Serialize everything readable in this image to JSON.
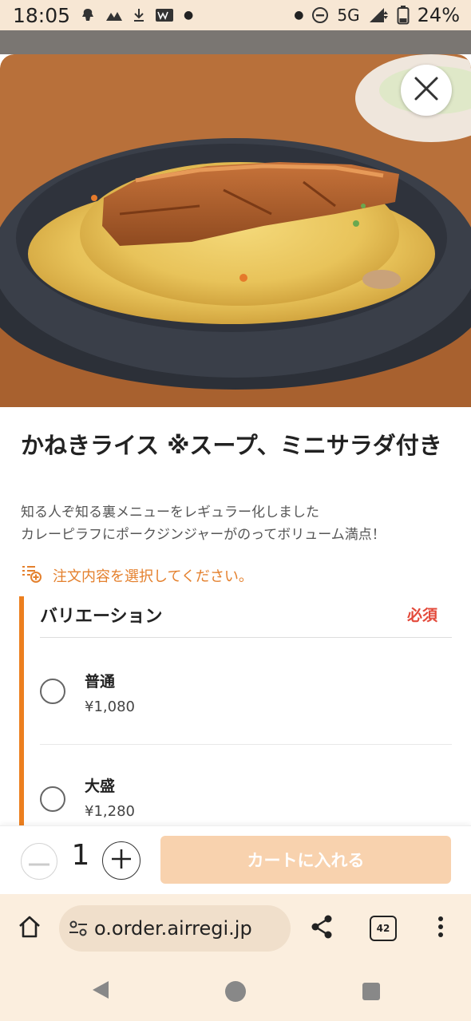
{
  "status_bar": {
    "time": "18:05",
    "network": "5G",
    "battery": "24%",
    "icons": [
      "notification-app-icon",
      "mountain-icon",
      "download-icon",
      "app-badge-icon",
      "dot-icon",
      "dot-icon",
      "do-not-disturb-icon",
      "signal-icon",
      "battery-icon"
    ]
  },
  "item": {
    "title": "かねきライス ※スープ、ミニサラダ付き",
    "description_lines": [
      "知る人ぞ知る裏メニューをレギュラー化しました",
      "カレーピラフにポークジンジャーがのってボリューム満点！"
    ],
    "notice": "注文内容を選択してください。"
  },
  "variation": {
    "title": "バリエーション",
    "required_label": "必須",
    "options": [
      {
        "name": "普通",
        "price": "¥1,080",
        "selected": false
      },
      {
        "name": "大盛",
        "price": "¥1,280",
        "selected": false
      }
    ]
  },
  "action_bar": {
    "quantity": "1",
    "cart_button_label": "カートに入れる"
  },
  "browser": {
    "url": "o.order.airregi.jp",
    "tab_count": "42"
  },
  "colors": {
    "accent": "#ec7f1f",
    "required": "#e34a3b",
    "cart_button": "#f8d2ae",
    "notice": "#e4802d"
  }
}
